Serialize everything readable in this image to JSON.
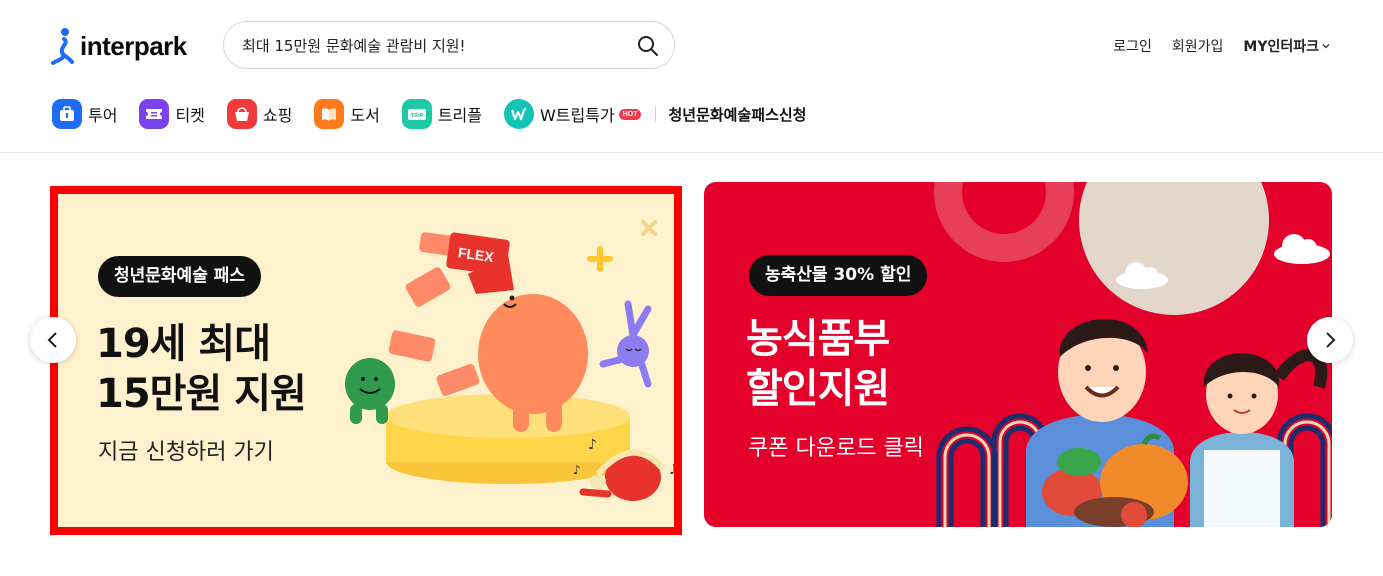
{
  "header": {
    "logo_text": "interpark",
    "search": {
      "value": "최대 15만원 문화예술 관람비 지원!"
    },
    "util_links": {
      "login": "로그인",
      "signup": "회원가입",
      "my": "MY인터파크"
    }
  },
  "nav": {
    "items": [
      {
        "label": "투어",
        "icon": "tour-bag-icon",
        "color": "#1e6cf5"
      },
      {
        "label": "티켓",
        "icon": "ticket-icon",
        "color": "#7b42f0"
      },
      {
        "label": "쇼핑",
        "icon": "shopping-bag-icon",
        "color": "#f23a3a"
      },
      {
        "label": "도서",
        "icon": "book-icon",
        "color": "#ff7a1a"
      },
      {
        "label": "트리플",
        "icon": "trip-icon",
        "color": "#1ec9a6"
      },
      {
        "label": "W트립특가",
        "icon": "w-trip-icon",
        "color": "#11c4b5",
        "badge": "HOT"
      }
    ],
    "special": "청년문화예술패스신청"
  },
  "banners": {
    "left": {
      "pill": "청년문화예술 패스",
      "headline_1": "19세 최대",
      "headline_2": "15만원 지원",
      "sub": "지금 신청하러 가기",
      "flag_text": "FLEX",
      "bg": "#fdf2cd"
    },
    "right": {
      "pill": "농축산물 30% 할인",
      "headline_1": "농식품부",
      "headline_2": "할인지원",
      "sub": "쿠폰 다운로드 클릭",
      "bg": "#e3002b"
    }
  },
  "colors": {
    "highlight_border": "#ff0000",
    "brand_blue": "#1e6cf5"
  }
}
